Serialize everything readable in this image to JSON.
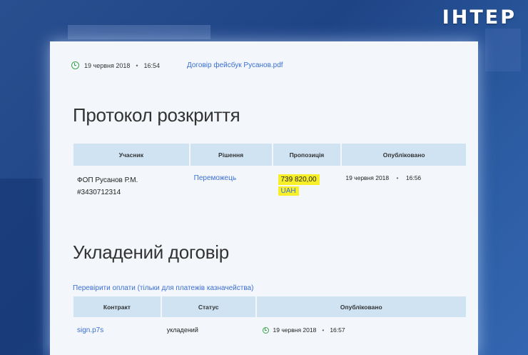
{
  "channel_logo": "ІНТЕР",
  "document": {
    "date": "19 червня 2018",
    "time": "16:54",
    "separator": "•",
    "file_link": "Договір фейсбук Русанов.pdf"
  },
  "protocol": {
    "title": "Протокол розкриття",
    "columns": [
      "Учасник",
      "Рішення",
      "Пропозиція",
      "Опубліковано"
    ],
    "row": {
      "participant_name": "ФОП Русанов Р.М.",
      "participant_id": "#3430712314",
      "decision": "Переможець",
      "amount": "739 820,00",
      "currency": "UAH",
      "published_date": "19 червня 2018",
      "published_time": "16:56"
    }
  },
  "contract": {
    "title": "Укладений договір",
    "verify_link": "Перевірити оплати (тільки для платежів казначейства)",
    "columns": [
      "Контракт",
      "Статус",
      "Опубліковано"
    ],
    "row": {
      "file": "sign.p7s",
      "status": "укладений",
      "published_date": "19 червня 2018",
      "published_time": "16:57"
    }
  },
  "colors": {
    "link": "#3b6fd6",
    "header_bg": "#cfe3f3",
    "highlight": "#f7ef2a",
    "clock": "#3ca64a"
  }
}
